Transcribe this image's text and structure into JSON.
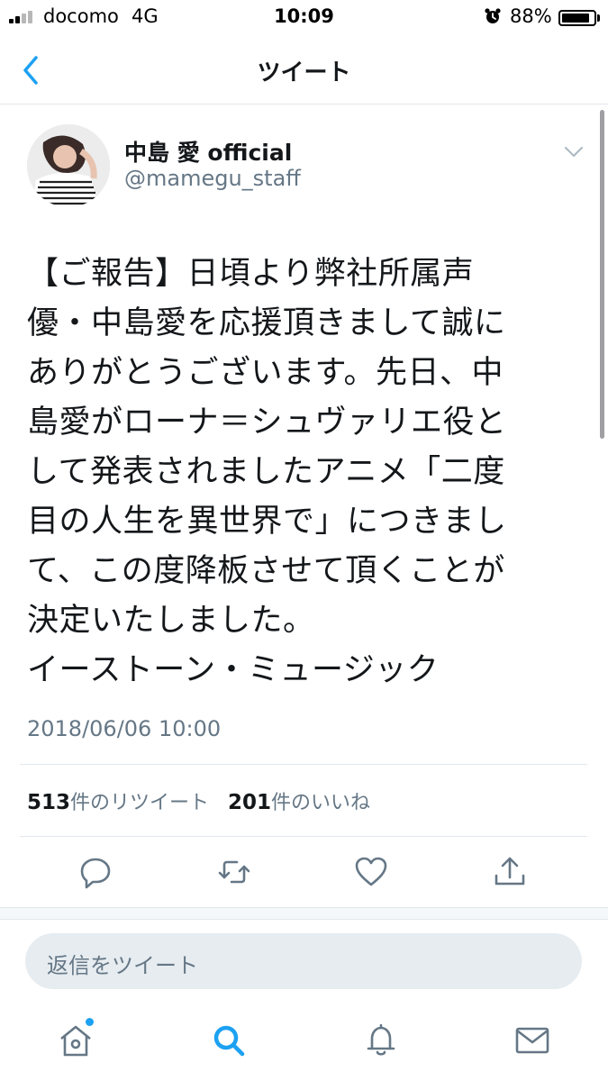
{
  "status_bar": {
    "carrier": "docomo",
    "network": "4G",
    "time": "10:09",
    "battery_percent": "88%",
    "battery_level": 0.88,
    "alarm_icon": "alarm-icon"
  },
  "nav": {
    "title": "ツイート",
    "back_icon": "chevron-left-icon"
  },
  "tweet": {
    "display_name": "中島 愛 official",
    "handle": "@mamegu_staff",
    "text_lines": [
      "【ご報告】日頃より弊社所属声",
      "優・中島愛を応援頂きまして誠に",
      "ありがとうございます。先日、中",
      "島愛がローナ＝シュヴァリエ役と",
      "して発表されましたアニメ「二度",
      "目の人生を異世界で」につきまし",
      "て、この度降板させて頂くことが",
      "決定いたしました。",
      "イーストーン・ミュージック"
    ],
    "timestamp": "2018/06/06 10:00"
  },
  "stats": {
    "retweets_count": "513",
    "retweets_label": "件のリツイート",
    "likes_count": "201",
    "likes_label": "件のいいね"
  },
  "actions": [
    "reply-icon",
    "retweet-icon",
    "like-icon",
    "share-icon"
  ],
  "reply": {
    "placeholder": "返信をツイート"
  },
  "tabbar": {
    "items": [
      "home-icon",
      "search-icon",
      "notifications-icon",
      "messages-icon"
    ],
    "active": "search-icon"
  },
  "colors": {
    "accent": "#1da1f2",
    "text": "#14171a",
    "secondary": "#657786",
    "border": "#e1e8ed"
  }
}
